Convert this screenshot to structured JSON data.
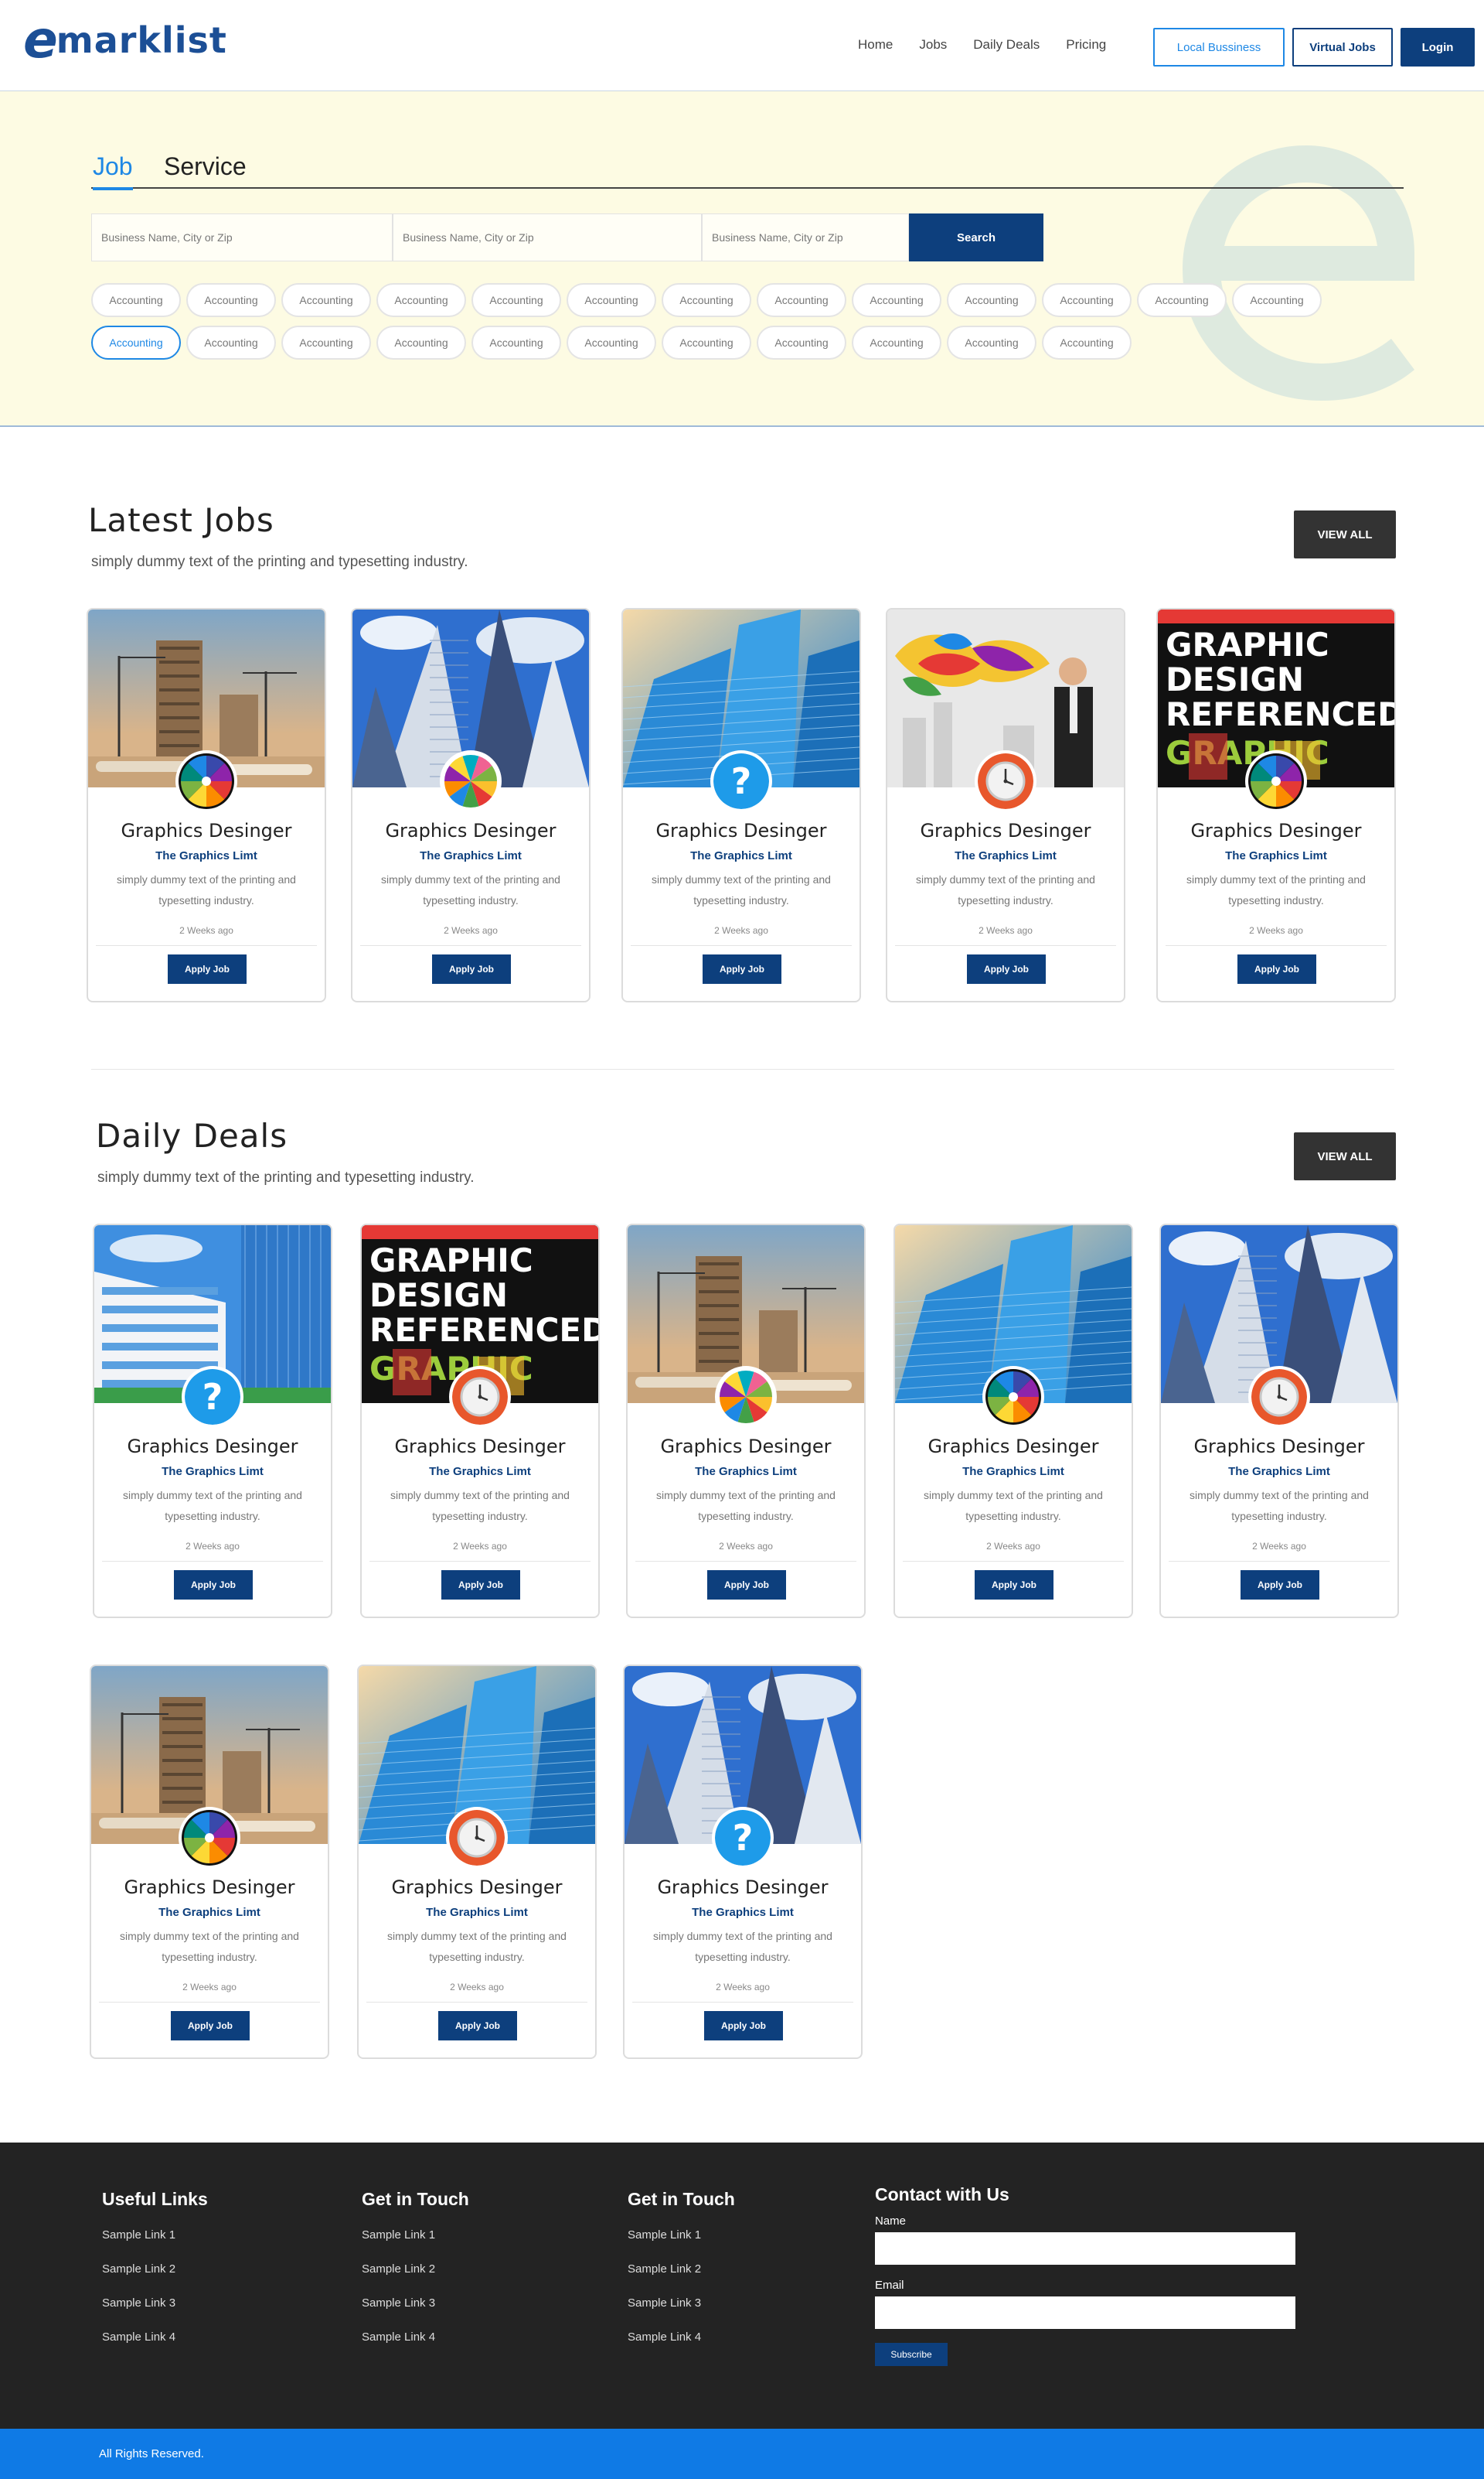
{
  "header": {
    "logo_e": "e",
    "logo_rest": "marklist",
    "nav": [
      "Home",
      "Jobs",
      "Daily Deals",
      "Pricing"
    ],
    "btn_local": "Local Bussiness",
    "btn_virtual": "Virtual Jobs",
    "btn_login": "Login"
  },
  "hero": {
    "tab_job": "Job",
    "tab_service": "Service",
    "search_placeholders": [
      "Business Name, City or Zip",
      "Business Name, City or Zip",
      "Business Name, City or Zip"
    ],
    "search_label": "Search",
    "tags_row1": [
      "Accounting",
      "Accounting",
      "Accounting",
      "Accounting",
      "Accounting",
      "Accounting",
      "Accounting",
      "Accounting",
      "Accounting",
      "Accounting",
      "Accounting",
      "Accounting",
      "Accounting"
    ],
    "tags_row2": [
      "Accounting",
      "Accounting",
      "Accounting",
      "Accounting",
      "Accounting",
      "Accounting",
      "Accounting",
      "Accounting",
      "Accounting",
      "Accounting",
      "Accounting"
    ]
  },
  "latest_jobs": {
    "title": "Latest Jobs",
    "subtitle": "simply dummy text of the printing and typesetting industry.",
    "view_all": "VIEW ALL"
  },
  "daily_deals": {
    "title": "Daily Deals",
    "subtitle": "simply dummy text of the printing and typesetting industry.",
    "view_all": "VIEW ALL"
  },
  "card": {
    "title": "Graphics Desinger",
    "company": "The Graphics Limt",
    "desc": "simply dummy text of the printing and typesetting industry.",
    "time": "2 Weeks ago",
    "apply": "Apply Job"
  },
  "cards_latest": [
    {
      "image": "construction-site-image",
      "badge": "color-wheel-icon"
    },
    {
      "image": "skyscrapers-image",
      "badge": "beach-ball-icon"
    },
    {
      "image": "glass-towers-image",
      "badge": "question-icon"
    },
    {
      "image": "man-paint-splash-image",
      "badge": "clock-icon"
    },
    {
      "image": "graphic-design-book-image",
      "badge": "color-wheel-icon"
    }
  ],
  "cards_deals": [
    {
      "image": "office-building-image",
      "badge": "question-icon"
    },
    {
      "image": "graphic-design-book-image",
      "badge": "clock-icon"
    },
    {
      "image": "construction-site-image",
      "badge": "beach-ball-icon"
    },
    {
      "image": "glass-towers-image",
      "badge": "color-wheel-icon"
    },
    {
      "image": "skyscrapers-image",
      "badge": "clock-icon"
    },
    {
      "image": "construction-site-image",
      "badge": "color-wheel-icon"
    },
    {
      "image": "glass-towers-image",
      "badge": "clock-icon"
    },
    {
      "image": "skyscrapers-image",
      "badge": "question-icon"
    }
  ],
  "footer": {
    "useful_links_title": "Useful Links",
    "get_in_touch_title": "Get in Touch",
    "get_in_touch_title2": "Get in Touch",
    "links": [
      "Sample Link 1",
      "Sample Link 2",
      "Sample Link 3",
      "Sample Link 4"
    ],
    "contact_title": "Contact with Us",
    "name_label": "Name",
    "email_label": "Email",
    "subscribe": "Subscribe",
    "copyright": "All Rights Reserved."
  },
  "colors": {
    "brand_blue": "#0d3f7d",
    "accent_blue": "#1e88e5",
    "hero_bg": "#fdfbe3",
    "footer_bg": "#232323",
    "copyright_bg": "#0f7ae5"
  }
}
